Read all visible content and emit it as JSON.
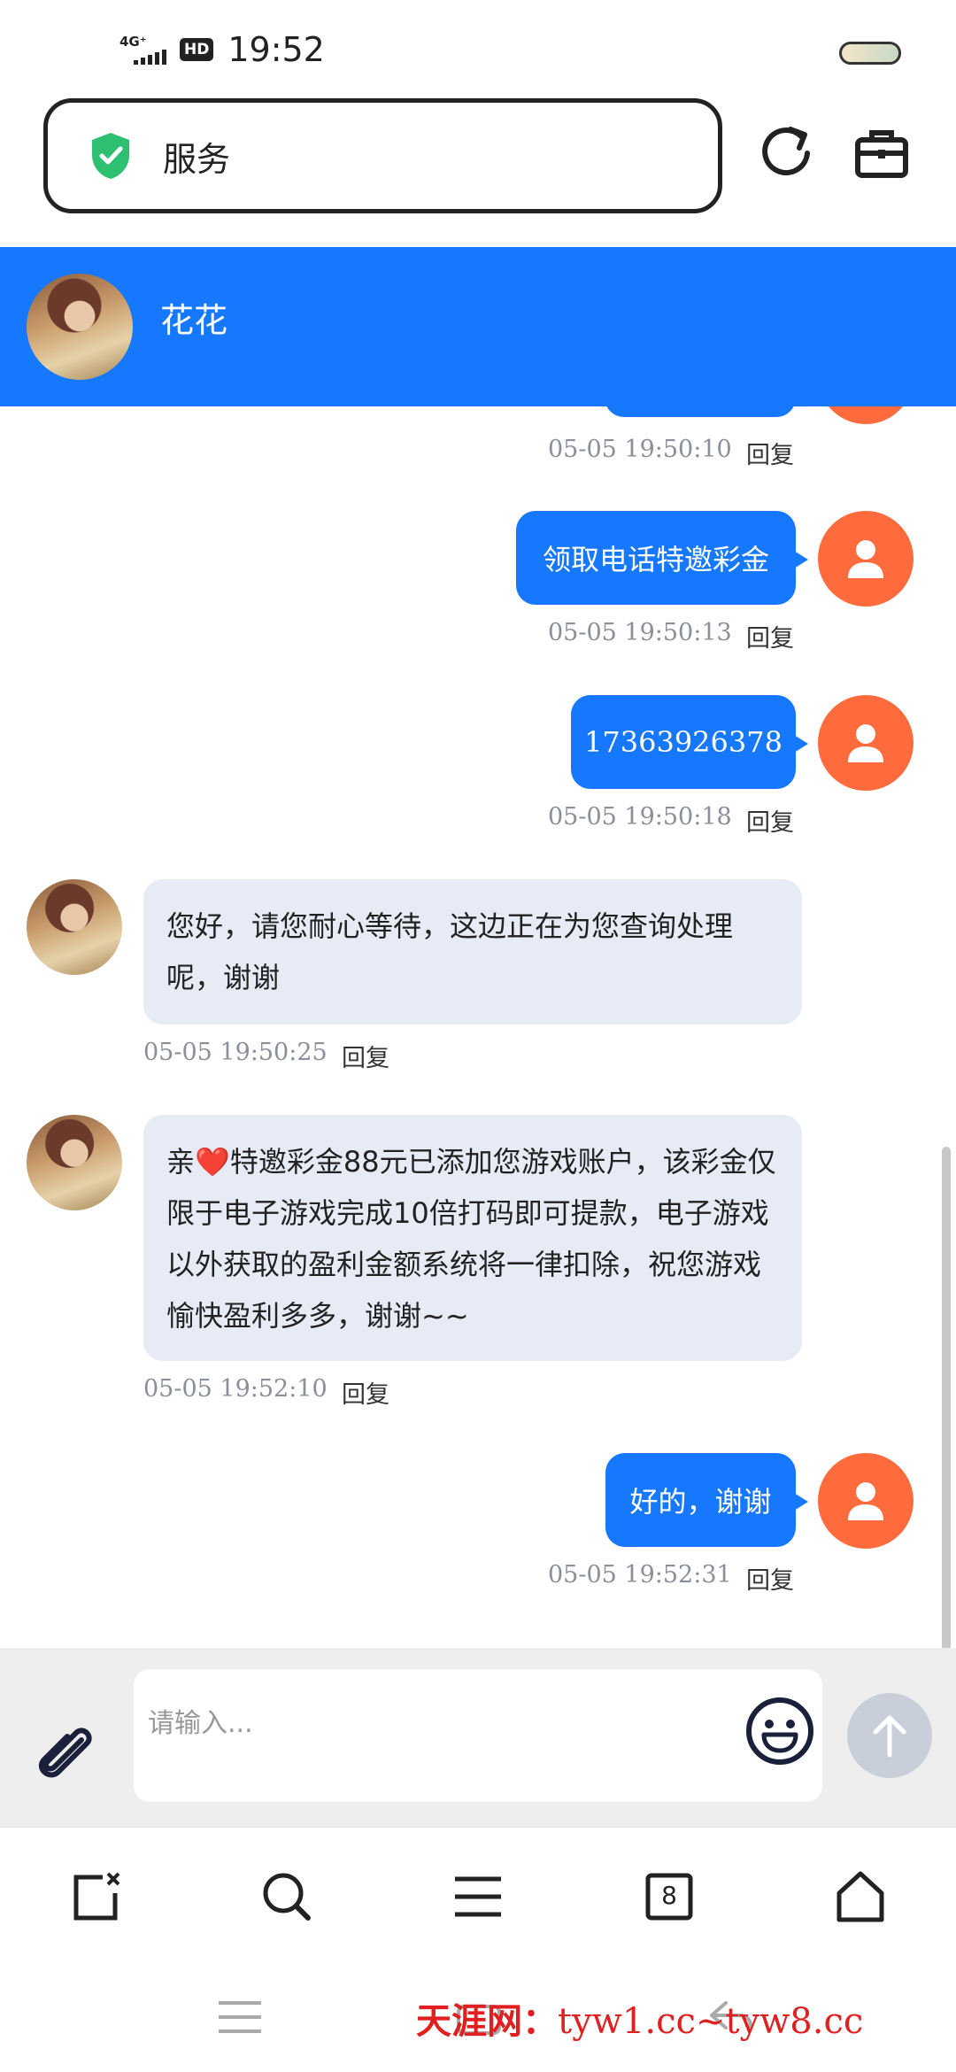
{
  "status_bar": {
    "network": "4G⁺",
    "hd_badge": "HD",
    "time": "19:52"
  },
  "browser": {
    "address_title": "服务"
  },
  "chat": {
    "contact_name": "花花",
    "messages": [
      {
        "from": "me",
        "text": "",
        "timestamp": "05-05 19:50:10",
        "reply_label": "回复"
      },
      {
        "from": "me",
        "text": "领取电话特邀彩金",
        "timestamp": "05-05 19:50:13",
        "reply_label": "回复"
      },
      {
        "from": "me",
        "text": "17363926378",
        "timestamp": "05-05 19:50:18",
        "reply_label": "回复"
      },
      {
        "from": "agent",
        "text": "您好，请您耐心等待，这边正在为您查询处理呢，谢谢",
        "timestamp": "05-05 19:50:25",
        "reply_label": "回复"
      },
      {
        "from": "agent",
        "text": "亲❤️特邀彩金88元已添加您游戏账户，该彩金仅限于电子游戏完成10倍打码即可提款，电子游戏以外获取的盈利金额系统将一律扣除，祝您游戏愉快盈利多多，谢谢~~",
        "timestamp": "05-05 19:52:10",
        "reply_label": "回复"
      },
      {
        "from": "me",
        "text": "好的，谢谢",
        "timestamp": "05-05 19:52:31",
        "reply_label": "回复"
      }
    ]
  },
  "input": {
    "placeholder": "请输入..."
  },
  "browser_toolbar": {
    "tab_count": "8"
  },
  "watermark": {
    "site": "天涯网：",
    "urls": "tyw1.cc~tyw8.cc"
  },
  "colors": {
    "primary": "#1677ff",
    "user_avatar": "#ff6b3d",
    "agent_bubble": "#e6ebf5",
    "watermark": "#e02020"
  }
}
